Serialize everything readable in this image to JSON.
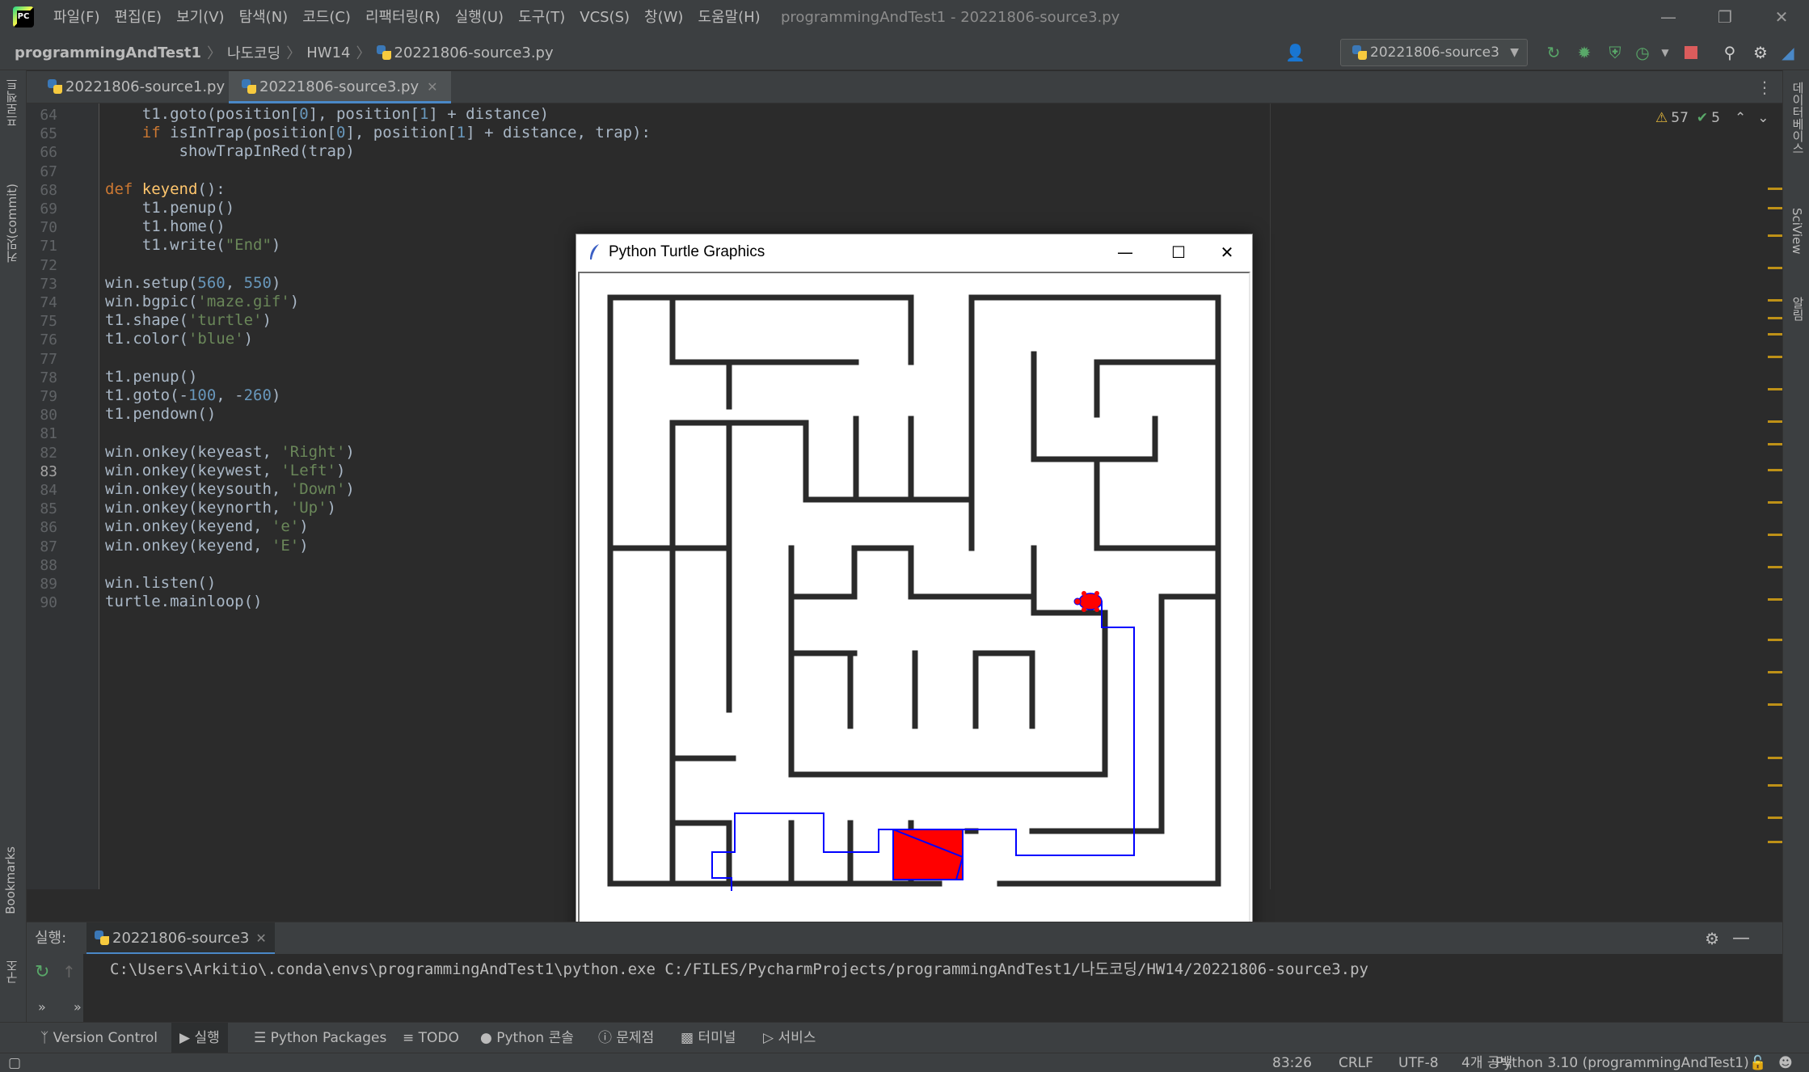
{
  "menu": [
    "파일(F)",
    "편집(E)",
    "보기(V)",
    "탐색(N)",
    "코드(C)",
    "리팩터링(R)",
    "실행(U)",
    "도구(T)",
    "VCS(S)",
    "창(W)",
    "도움말(H)"
  ],
  "window_title": "programmingAndTest1 - 20221806-source3.py",
  "breadcrumb": [
    "programmingAndTest1",
    "나도코딩",
    "HW14",
    "20221806-source3.py"
  ],
  "run_config": "20221806-source3",
  "tabs": [
    {
      "label": "20221806-source1.py",
      "active": false
    },
    {
      "label": "20221806-source3.py",
      "active": true
    }
  ],
  "left_strip": {
    "project": "프로젝트",
    "commit": "커밋(commit)",
    "bookmarks": "Bookmarks",
    "structure": "구조"
  },
  "right_strip": {
    "database": "데이터베이스",
    "sciview": "SciView",
    "notifications": "알림"
  },
  "inspections": {
    "warnings": "57",
    "weak_warnings": "5"
  },
  "code_lines": [
    {
      "n": "64",
      "t": "    t1.goto(position[0], position[1] + distance)"
    },
    {
      "n": "65",
      "t": "    if isInTrap(position[0], position[1] + distance, trap):"
    },
    {
      "n": "66",
      "t": "        showTrapInRed(trap)"
    },
    {
      "n": "67",
      "t": ""
    },
    {
      "n": "68",
      "t": "def keyend():"
    },
    {
      "n": "69",
      "t": "    t1.penup()"
    },
    {
      "n": "70",
      "t": "    t1.home()"
    },
    {
      "n": "71",
      "t": "    t1.write(\"End\")"
    },
    {
      "n": "72",
      "t": ""
    },
    {
      "n": "73",
      "t": "win.setup(560, 550)"
    },
    {
      "n": "74",
      "t": "win.bgpic('maze.gif')"
    },
    {
      "n": "75",
      "t": "t1.shape('turtle')"
    },
    {
      "n": "76",
      "t": "t1.color('blue')"
    },
    {
      "n": "77",
      "t": ""
    },
    {
      "n": "78",
      "t": "t1.penup()"
    },
    {
      "n": "79",
      "t": "t1.goto(-100, -260)"
    },
    {
      "n": "80",
      "t": "t1.pendown()"
    },
    {
      "n": "81",
      "t": ""
    },
    {
      "n": "82",
      "t": "win.onkey(keyeast, 'Right')"
    },
    {
      "n": "83",
      "t": "win.onkey(keywest, 'Left')"
    },
    {
      "n": "84",
      "t": "win.onkey(keysouth, 'Down')"
    },
    {
      "n": "85",
      "t": "win.onkey(keynorth, 'Up')"
    },
    {
      "n": "86",
      "t": "win.onkey(keyend, 'e')"
    },
    {
      "n": "87",
      "t": "win.onkey(keyend, 'E')"
    },
    {
      "n": "88",
      "t": ""
    },
    {
      "n": "89",
      "t": "win.listen()"
    },
    {
      "n": "90",
      "t": "turtle.mainloop()"
    }
  ],
  "current_line": "83",
  "turtle_window": {
    "title": "Python Turtle Graphics",
    "turtle_color": "#ff0000",
    "path_color": "#0000ff",
    "trap_color": "#ff0000"
  },
  "run_panel": {
    "label": "실행:",
    "tab": "20221806-source3",
    "command": "C:\\Users\\Arkitio\\.conda\\envs\\programmingAndTest1\\python.exe C:/FILES/PycharmProjects/programmingAndTest1/나도코딩/HW14/20221806-source3.py"
  },
  "bottom_tools": [
    "Version Control",
    "실행",
    "Python Packages",
    "TODO",
    "Python 콘솔",
    "문제점",
    "터미널",
    "서비스"
  ],
  "status": {
    "position": "83:26",
    "line_sep": "CRLF",
    "encoding": "UTF-8",
    "indent": "4개 공백",
    "interpreter": "Python 3.10 (programmingAndTest1)"
  }
}
